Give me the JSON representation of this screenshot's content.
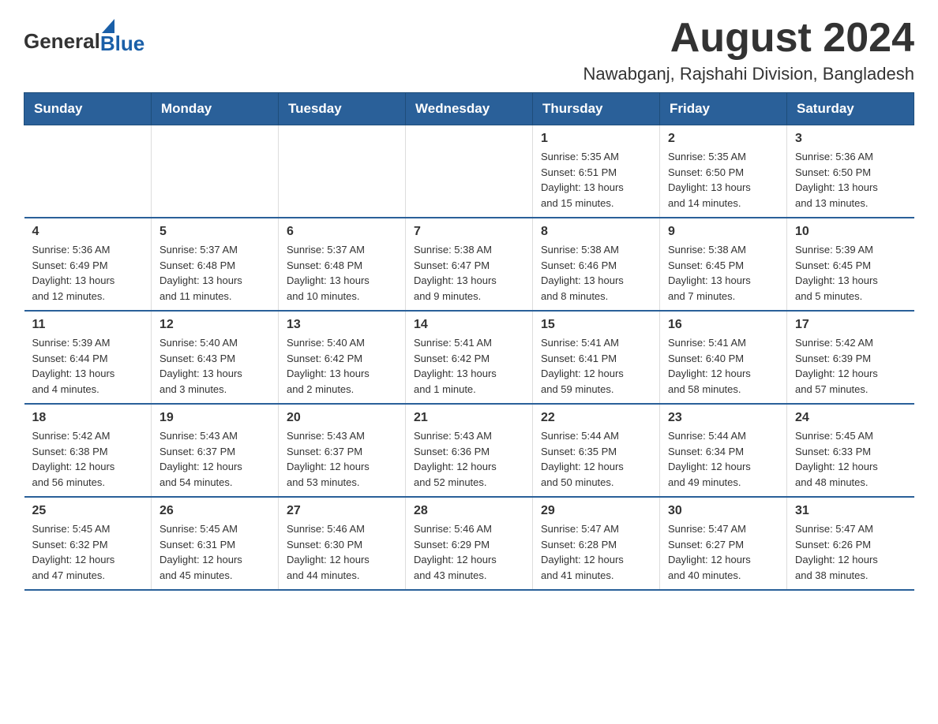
{
  "logo": {
    "general": "General",
    "blue": "Blue"
  },
  "title": {
    "month_year": "August 2024",
    "location": "Nawabganj, Rajshahi Division, Bangladesh"
  },
  "headers": [
    "Sunday",
    "Monday",
    "Tuesday",
    "Wednesday",
    "Thursday",
    "Friday",
    "Saturday"
  ],
  "weeks": [
    [
      {
        "day": "",
        "info": ""
      },
      {
        "day": "",
        "info": ""
      },
      {
        "day": "",
        "info": ""
      },
      {
        "day": "",
        "info": ""
      },
      {
        "day": "1",
        "info": "Sunrise: 5:35 AM\nSunset: 6:51 PM\nDaylight: 13 hours\nand 15 minutes."
      },
      {
        "day": "2",
        "info": "Sunrise: 5:35 AM\nSunset: 6:50 PM\nDaylight: 13 hours\nand 14 minutes."
      },
      {
        "day": "3",
        "info": "Sunrise: 5:36 AM\nSunset: 6:50 PM\nDaylight: 13 hours\nand 13 minutes."
      }
    ],
    [
      {
        "day": "4",
        "info": "Sunrise: 5:36 AM\nSunset: 6:49 PM\nDaylight: 13 hours\nand 12 minutes."
      },
      {
        "day": "5",
        "info": "Sunrise: 5:37 AM\nSunset: 6:48 PM\nDaylight: 13 hours\nand 11 minutes."
      },
      {
        "day": "6",
        "info": "Sunrise: 5:37 AM\nSunset: 6:48 PM\nDaylight: 13 hours\nand 10 minutes."
      },
      {
        "day": "7",
        "info": "Sunrise: 5:38 AM\nSunset: 6:47 PM\nDaylight: 13 hours\nand 9 minutes."
      },
      {
        "day": "8",
        "info": "Sunrise: 5:38 AM\nSunset: 6:46 PM\nDaylight: 13 hours\nand 8 minutes."
      },
      {
        "day": "9",
        "info": "Sunrise: 5:38 AM\nSunset: 6:45 PM\nDaylight: 13 hours\nand 7 minutes."
      },
      {
        "day": "10",
        "info": "Sunrise: 5:39 AM\nSunset: 6:45 PM\nDaylight: 13 hours\nand 5 minutes."
      }
    ],
    [
      {
        "day": "11",
        "info": "Sunrise: 5:39 AM\nSunset: 6:44 PM\nDaylight: 13 hours\nand 4 minutes."
      },
      {
        "day": "12",
        "info": "Sunrise: 5:40 AM\nSunset: 6:43 PM\nDaylight: 13 hours\nand 3 minutes."
      },
      {
        "day": "13",
        "info": "Sunrise: 5:40 AM\nSunset: 6:42 PM\nDaylight: 13 hours\nand 2 minutes."
      },
      {
        "day": "14",
        "info": "Sunrise: 5:41 AM\nSunset: 6:42 PM\nDaylight: 13 hours\nand 1 minute."
      },
      {
        "day": "15",
        "info": "Sunrise: 5:41 AM\nSunset: 6:41 PM\nDaylight: 12 hours\nand 59 minutes."
      },
      {
        "day": "16",
        "info": "Sunrise: 5:41 AM\nSunset: 6:40 PM\nDaylight: 12 hours\nand 58 minutes."
      },
      {
        "day": "17",
        "info": "Sunrise: 5:42 AM\nSunset: 6:39 PM\nDaylight: 12 hours\nand 57 minutes."
      }
    ],
    [
      {
        "day": "18",
        "info": "Sunrise: 5:42 AM\nSunset: 6:38 PM\nDaylight: 12 hours\nand 56 minutes."
      },
      {
        "day": "19",
        "info": "Sunrise: 5:43 AM\nSunset: 6:37 PM\nDaylight: 12 hours\nand 54 minutes."
      },
      {
        "day": "20",
        "info": "Sunrise: 5:43 AM\nSunset: 6:37 PM\nDaylight: 12 hours\nand 53 minutes."
      },
      {
        "day": "21",
        "info": "Sunrise: 5:43 AM\nSunset: 6:36 PM\nDaylight: 12 hours\nand 52 minutes."
      },
      {
        "day": "22",
        "info": "Sunrise: 5:44 AM\nSunset: 6:35 PM\nDaylight: 12 hours\nand 50 minutes."
      },
      {
        "day": "23",
        "info": "Sunrise: 5:44 AM\nSunset: 6:34 PM\nDaylight: 12 hours\nand 49 minutes."
      },
      {
        "day": "24",
        "info": "Sunrise: 5:45 AM\nSunset: 6:33 PM\nDaylight: 12 hours\nand 48 minutes."
      }
    ],
    [
      {
        "day": "25",
        "info": "Sunrise: 5:45 AM\nSunset: 6:32 PM\nDaylight: 12 hours\nand 47 minutes."
      },
      {
        "day": "26",
        "info": "Sunrise: 5:45 AM\nSunset: 6:31 PM\nDaylight: 12 hours\nand 45 minutes."
      },
      {
        "day": "27",
        "info": "Sunrise: 5:46 AM\nSunset: 6:30 PM\nDaylight: 12 hours\nand 44 minutes."
      },
      {
        "day": "28",
        "info": "Sunrise: 5:46 AM\nSunset: 6:29 PM\nDaylight: 12 hours\nand 43 minutes."
      },
      {
        "day": "29",
        "info": "Sunrise: 5:47 AM\nSunset: 6:28 PM\nDaylight: 12 hours\nand 41 minutes."
      },
      {
        "day": "30",
        "info": "Sunrise: 5:47 AM\nSunset: 6:27 PM\nDaylight: 12 hours\nand 40 minutes."
      },
      {
        "day": "31",
        "info": "Sunrise: 5:47 AM\nSunset: 6:26 PM\nDaylight: 12 hours\nand 38 minutes."
      }
    ]
  ]
}
